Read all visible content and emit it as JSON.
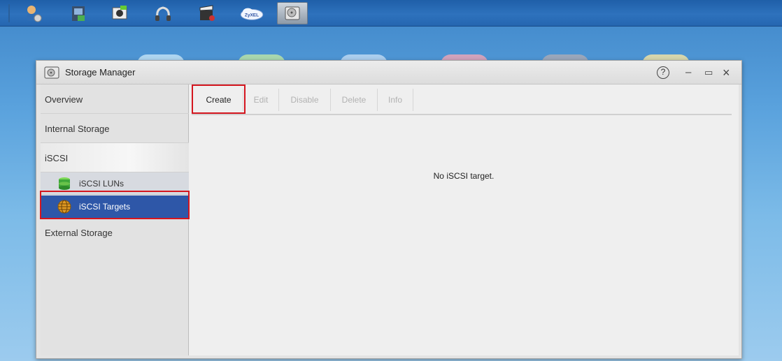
{
  "taskbar": {
    "icons": [
      "admin-user-icon",
      "file-browser-icon",
      "photo-icon",
      "music-icon",
      "video-icon",
      "zyxel-cloud-icon",
      "storage-manager-icon"
    ],
    "cloud_label": "ZyXEL"
  },
  "window": {
    "title": "Storage Manager",
    "help": "?",
    "minimize": "–",
    "maximize": "▭",
    "close": "×"
  },
  "sidebar": {
    "items": [
      {
        "label": "Overview"
      },
      {
        "label": "Internal Storage"
      },
      {
        "label": "iSCSI"
      },
      {
        "label": "External Storage"
      }
    ],
    "subitems": [
      {
        "label": "iSCSI LUNs"
      },
      {
        "label": "iSCSI Targets",
        "selected": true
      }
    ]
  },
  "toolbar": {
    "create": "Create",
    "edit": "Edit",
    "disable": "Disable",
    "delete": "Delete",
    "info": "Info"
  },
  "content": {
    "empty_message": "No iSCSI target."
  },
  "colors": {
    "selected": "#2e57a8",
    "highlight": "#d4161f",
    "desktop": "#5aa2dd"
  }
}
